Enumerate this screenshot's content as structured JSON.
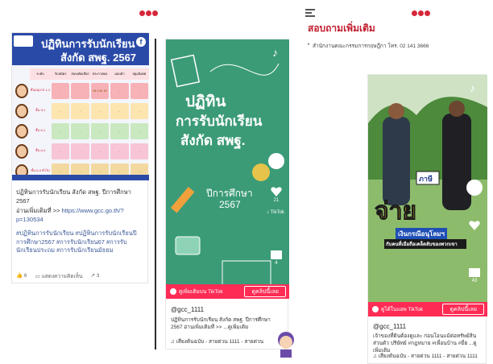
{
  "header": {
    "logo_left_alt": "gcc logo",
    "logo_right_alt": "gcc logo"
  },
  "fb_post": {
    "banner_title_line1": "ปฏิทินการรับนักเรียน",
    "banner_title_line2": "สังกัด สพฐ. 2567",
    "table_headers": [
      "ระดับ",
      "รับสมัคร",
      "สอบ/คัดเลือก",
      "ประกาศผล",
      "มอบตัว",
      "ปฐมนิเทศ"
    ],
    "rows": [
      {
        "level": "ชั้นอนุบาล 1-2",
        "cells": [
          "-",
          "-",
          "16 ก.พ. 67",
          "-",
          "-"
        ],
        "color": "#f7b2b8"
      },
      {
        "level": "ชั้น ป.1",
        "cells": [
          "-",
          "-",
          "-",
          "-",
          "-"
        ],
        "color": "#fde5b0"
      },
      {
        "level": "ชั้น ม.1",
        "cells": [
          "-",
          "-",
          "-",
          "-",
          "-"
        ],
        "color": "#c9e8c0"
      },
      {
        "level": "ชั้น ม.4",
        "cells": [
          "-",
          "-",
          "-",
          "-",
          "-"
        ],
        "color": "#f7c5d6"
      },
      {
        "level": "ชั้น ม.4 ทั่วไป",
        "cells": [
          "-",
          "-",
          "-",
          "-",
          "-"
        ],
        "color": "#f3d9a0"
      }
    ],
    "text_title": "ปฏิทินการรับนักเรียน สังกัด สพฐ. ปีการศึกษา 2567",
    "read_more": "อ่านเพิ่มเติมที่ >> ",
    "link": "https://www.gcc.go.th/?p=130534",
    "hashtags": "#ปฏิทินการรับนักเรียน #ปฏิทินการรับนักเรียนปีการศึกษา2567 #การรับนักเรียน67 #การรับนักเรียนประถม #การรับนักเรียนมัธยม",
    "likes": "6",
    "comment_label": "แสดงความคิดเห็น",
    "shares": "3"
  },
  "tiktok_1": {
    "video_title_line1": "ปฏิทิน",
    "video_title_line2": "การรับนักเรียน",
    "video_title_line3": "สังกัด สพฐ.",
    "year_label_line1": "ปีการศึกษา",
    "year_label_line2": "2567",
    "like_count": "21",
    "share_count": "4",
    "brand": "TikTok",
    "watch_label": "ดูเพิ่มเติมบน TikTok",
    "cta_button": "ดูคลิปนี้เลย",
    "username": "@gcc_1111",
    "caption": "ปฏิทินการรับนักเรียน สังกัด สพฐ. ปีการศึกษา 2567 อ่านเพิ่มเติมที่ >> ...ดูเพิ่มเติม",
    "music": "เสียงต้นฉบับ - สายด่วน 1111 - สายด่วน",
    "bg_color": "#3b9b77"
  },
  "info_section": {
    "title": "สอบถามเพิ่มเติม",
    "contact": "สำนักงานคณะกรรมการกฤษฎีกา โทร. 02 141 3666"
  },
  "tiktok_2": {
    "overlay_text": "จ่าย",
    "overlay_sub": "เงินกรณีอนุโลมฯ",
    "overlay_sub2": "กับคนที่เมือถือเคล็ดลับของพวกเขา",
    "sign_text": "ภาษี",
    "share_count": "43",
    "watch_label": "ดูได้ในแอพ TikTok",
    "cta_button": "ดูคลิปนี้เลย",
    "username": "@gcc_1111",
    "caption": "เจ้าของที่ดินต้องดูและ ก่อนโอนแม้ต่อทรัพย์สินส่วนตัว ปริษัทย์ #กฎหมาย #เพื่อนบ้าน #ยี่ฮ ...ดูเพิ่มเติม",
    "music": "เสียงต้นฉบับ - สายด่วน 1111 - สายด่วน 1111"
  }
}
